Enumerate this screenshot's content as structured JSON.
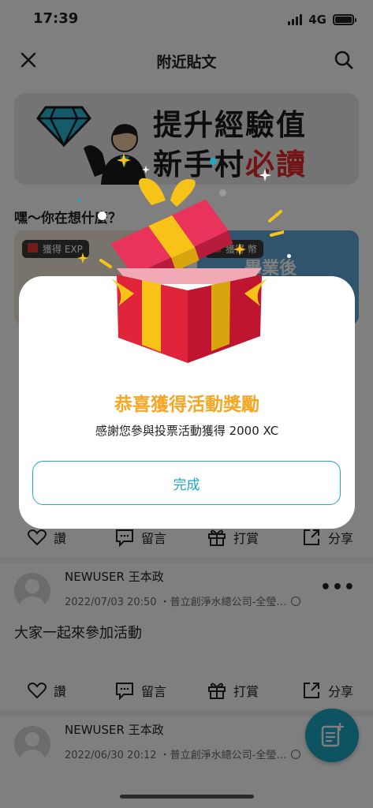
{
  "status_bar": {
    "time": "17:39",
    "network": "4G"
  },
  "header": {
    "title": "附近貼文"
  },
  "banner": {
    "line1": "提升經驗值",
    "line2_prefix": "新手村",
    "line2_accent": "必讀"
  },
  "feed": {
    "prompt": "嘿～你在想什麼？",
    "cards": [
      {
        "badge": "獲得 EXP"
      },
      {
        "badge": "獲得 幣",
        "headline": "畢業後"
      }
    ],
    "actions": {
      "like": "讚",
      "comment": "留言",
      "tip": "打賞",
      "share": "分享"
    },
    "posts": [
      {
        "username": "NEWUSER 王本政",
        "meta": "2022/07/03 20:50 ・普立創淨水總公司-全瑩…",
        "text": "大家一起來參加活動"
      },
      {
        "username": "NEWUSER 王本政",
        "meta": "2022/06/30 20:12 ・普立創淨水總公司-全瑩…"
      }
    ]
  },
  "modal": {
    "title": "恭喜獲得活動獎勵",
    "subtitle": "感謝您參與投票活動獲得 2000 XC",
    "button": "完成"
  },
  "colors": {
    "accent": "#1da7c2",
    "reward": "#f5a623",
    "gift_red": "#e0243a",
    "ribbon": "#f7c318"
  }
}
